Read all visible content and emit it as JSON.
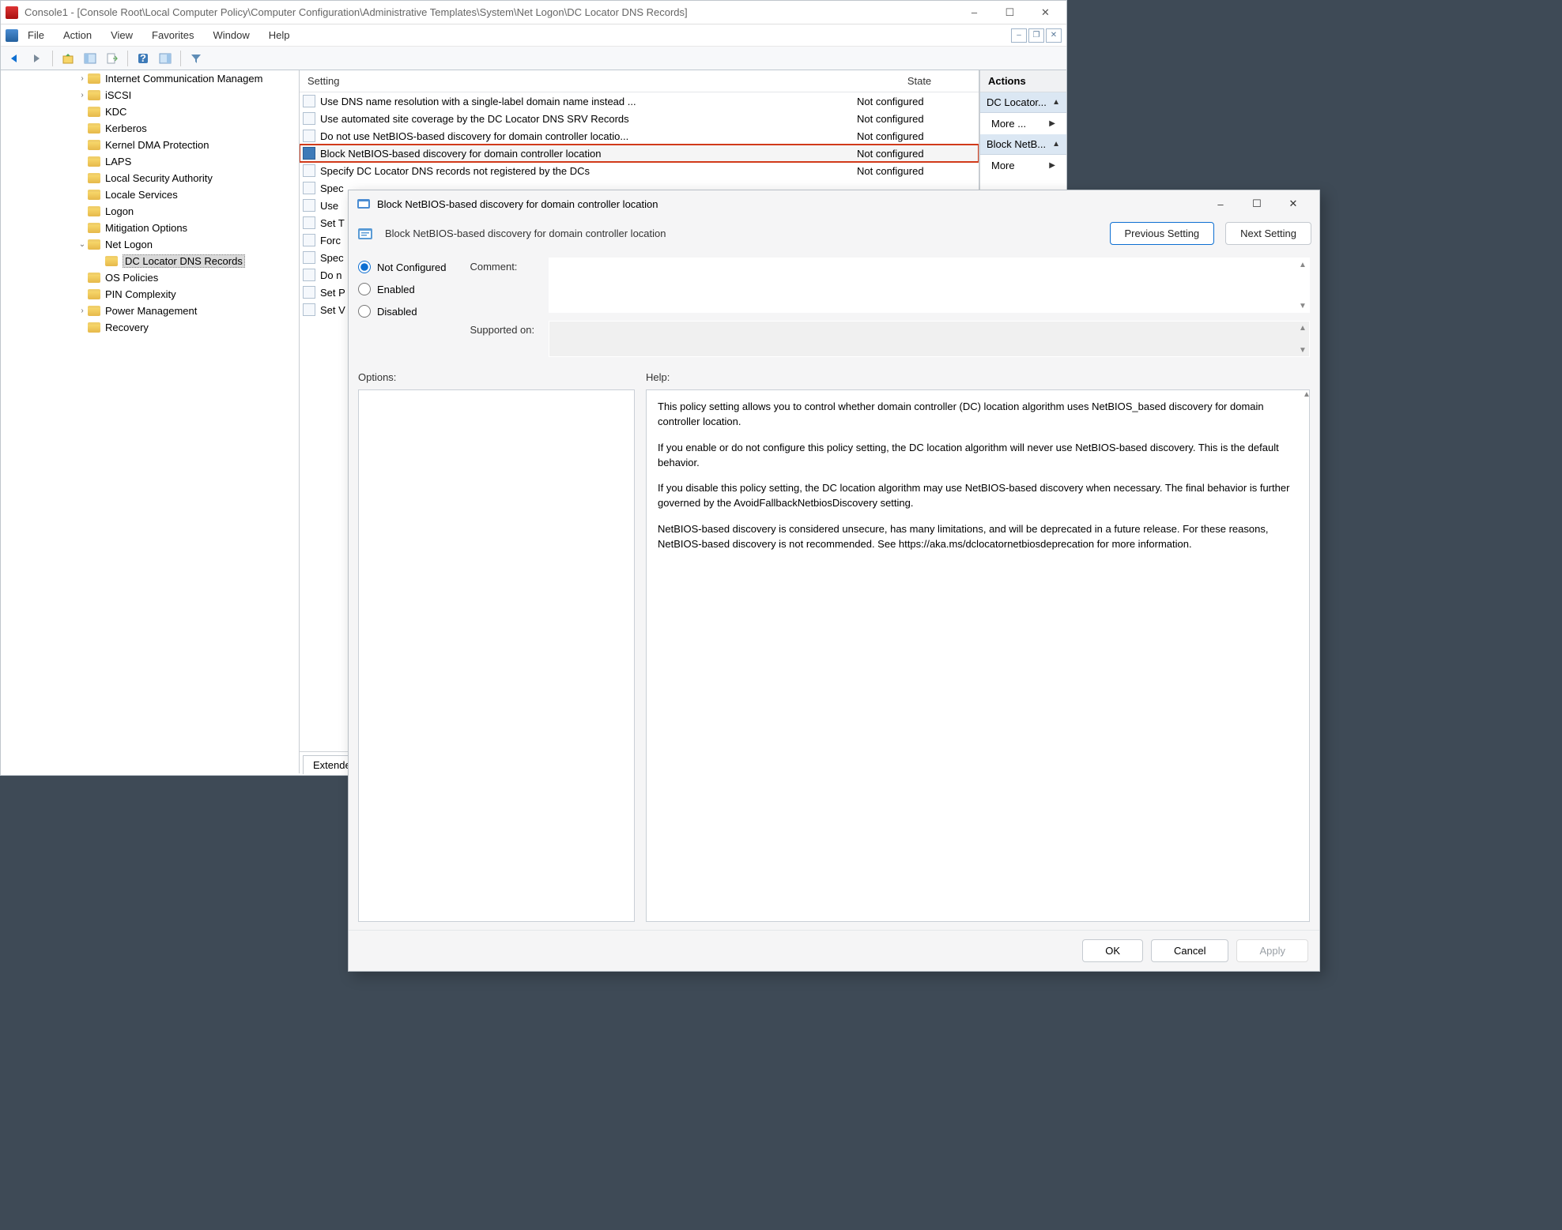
{
  "window": {
    "title": "Console1 - [Console Root\\Local Computer Policy\\Computer Configuration\\Administrative Templates\\System\\Net Logon\\DC Locator DNS Records]"
  },
  "menu": {
    "file": "File",
    "action": "Action",
    "view": "View",
    "favorites": "Favorites",
    "window": "Window",
    "help": "Help"
  },
  "tree": {
    "items": [
      {
        "label": "Internet Communication Managem",
        "expandable": true
      },
      {
        "label": "iSCSI",
        "expandable": true
      },
      {
        "label": "KDC",
        "expandable": false
      },
      {
        "label": "Kerberos",
        "expandable": false
      },
      {
        "label": "Kernel DMA Protection",
        "expandable": false
      },
      {
        "label": "LAPS",
        "expandable": false
      },
      {
        "label": "Local Security Authority",
        "expandable": false
      },
      {
        "label": "Locale Services",
        "expandable": false
      },
      {
        "label": "Logon",
        "expandable": false
      },
      {
        "label": "Mitigation Options",
        "expandable": false
      },
      {
        "label": "Net Logon",
        "expandable": true,
        "expanded": true
      },
      {
        "label": "DC Locator DNS Records",
        "expandable": false,
        "depth": 2,
        "selected": true
      },
      {
        "label": "OS Policies",
        "expandable": false
      },
      {
        "label": "PIN Complexity",
        "expandable": false
      },
      {
        "label": "Power Management",
        "expandable": true
      },
      {
        "label": "Recovery",
        "expandable": false
      }
    ]
  },
  "list": {
    "header": {
      "setting": "Setting",
      "state": "State"
    },
    "rows": [
      {
        "setting": "Use DNS name resolution with a single-label domain name instead ...",
        "state": "Not configured"
      },
      {
        "setting": "Use automated site coverage by the DC Locator DNS SRV Records",
        "state": "Not configured"
      },
      {
        "setting": "Do not use NetBIOS-based discovery for domain controller locatio...",
        "state": "Not configured"
      },
      {
        "setting": "Block NetBIOS-based discovery for domain controller location",
        "state": "Not configured",
        "highlight": true
      },
      {
        "setting": "Specify DC Locator DNS records not registered by the DCs",
        "state": "Not configured"
      },
      {
        "setting": "Spec",
        "state": ""
      },
      {
        "setting": "Use",
        "state": ""
      },
      {
        "setting": "Set T",
        "state": ""
      },
      {
        "setting": "Forc",
        "state": ""
      },
      {
        "setting": "Spec",
        "state": ""
      },
      {
        "setting": "Do n",
        "state": ""
      },
      {
        "setting": "Set P",
        "state": ""
      },
      {
        "setting": "Set V",
        "state": ""
      }
    ],
    "extendedTab": "Extende"
  },
  "actions": {
    "header": "Actions",
    "group1": "DC Locator...",
    "more1": "More ...",
    "group2": "Block NetB...",
    "more2": "More"
  },
  "dialog": {
    "title": "Block NetBIOS-based discovery for domain controller location",
    "secondTitle": "Block NetBIOS-based discovery for domain controller location",
    "prevBtn": "Previous Setting",
    "nextBtn": "Next Setting",
    "radios": {
      "notConfigured": "Not Configured",
      "enabled": "Enabled",
      "disabled": "Disabled"
    },
    "commentLabel": "Comment:",
    "supportedLabel": "Supported on:",
    "optionsLabel": "Options:",
    "helpLabel": "Help:",
    "helpText": {
      "p1": "This policy setting allows you to control whether domain controller (DC) location algorithm uses NetBIOS_based discovery for domain controller location.",
      "p2": "If you enable or do not configure this policy setting, the DC location algorithm will never use NetBIOS-based discovery. This is the default behavior.",
      "p3": "If you disable this policy setting, the DC location algorithm may use NetBIOS-based discovery when necessary. The final behavior is further governed by the AvoidFallbackNetbiosDiscovery setting.",
      "p4": "NetBIOS-based discovery is considered unsecure, has many limitations, and will be deprecated in a future release. For these reasons, NetBIOS-based discovery is not recommended. See https://aka.ms/dclocatornetbiosdeprecation for more information."
    },
    "buttons": {
      "ok": "OK",
      "cancel": "Cancel",
      "apply": "Apply"
    }
  }
}
